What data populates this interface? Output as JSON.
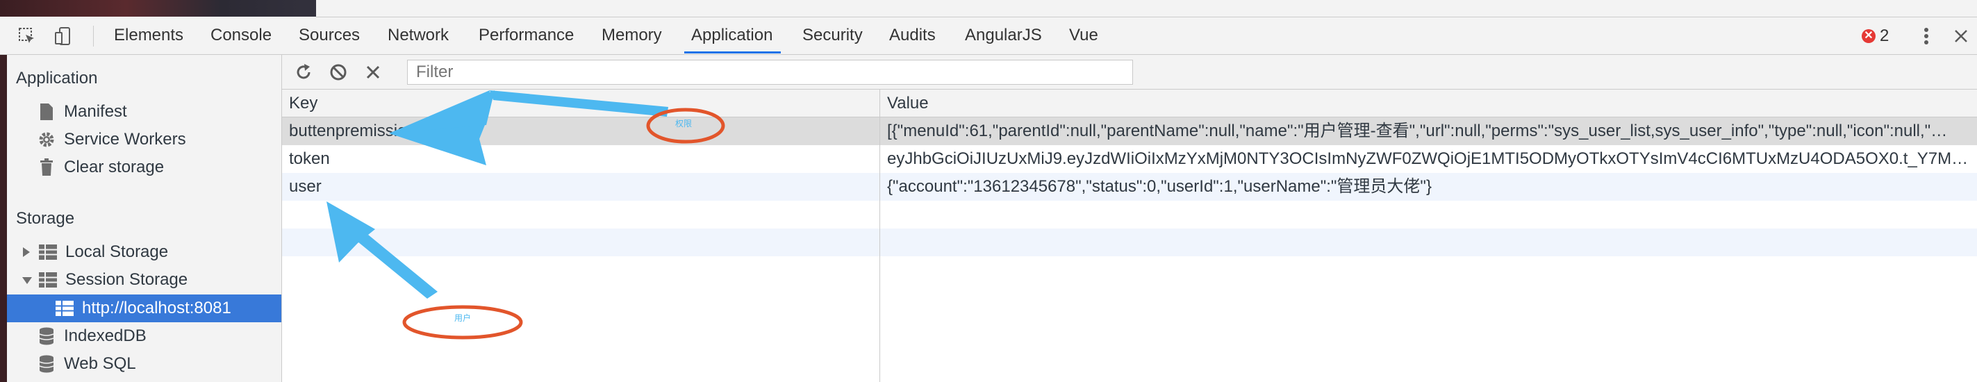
{
  "tabs": [
    "Elements",
    "Console",
    "Sources",
    "Network",
    "Performance",
    "Memory",
    "Application",
    "Security",
    "Audits",
    "AngularJS",
    "Vue"
  ],
  "active_tab": "Application",
  "error_count": "2",
  "sidebar": {
    "application_heading": "Application",
    "application_items": [
      {
        "label": "Manifest",
        "icon": "file-icon"
      },
      {
        "label": "Service Workers",
        "icon": "gear-icon"
      },
      {
        "label": "Clear storage",
        "icon": "trash-icon"
      }
    ],
    "storage_heading": "Storage",
    "storage_items": [
      {
        "label": "Local Storage",
        "icon": "grid-icon",
        "expand": "collapsed"
      },
      {
        "label": "Session Storage",
        "icon": "grid-icon",
        "expand": "expanded"
      },
      {
        "label": "http://localhost:8081",
        "icon": "grid-icon",
        "selected": true
      },
      {
        "label": "IndexedDB",
        "icon": "database-icon"
      },
      {
        "label": "Web SQL",
        "icon": "database-icon"
      }
    ]
  },
  "filter": {
    "placeholder": "Filter",
    "value": ""
  },
  "table": {
    "headers": [
      "Key",
      "Value"
    ],
    "rows": [
      {
        "key": "buttenpremissions",
        "value": "[{\"menuId\":61,\"parentId\":null,\"parentName\":null,\"name\":\"用户管理-查看\",\"url\":null,\"perms\":\"sys_user_list,sys_user_info\",\"type\":null,\"icon\":null,\"…"
      },
      {
        "key": "token",
        "value": "eyJhbGciOiJIUzUxMiJ9.eyJzdWIiOiIxMzYxMjM0NTY3OCIsImNyZWF0ZWQiOjE1MTI5ODMyOTkxOTYsImV4cCI6MTUxMzU4ODA5OX0.t_Y7Mm…"
      },
      {
        "key": "user",
        "value": "{\"account\":\"13612345678\",\"status\":0,\"userId\":1,\"userName\":\"管理员大佬\"}"
      }
    ]
  },
  "annotations": {
    "label_top": "权限",
    "label_bottom": "用户",
    "arrow_color": "#4db8f0",
    "circle_color": "#e2552b"
  }
}
